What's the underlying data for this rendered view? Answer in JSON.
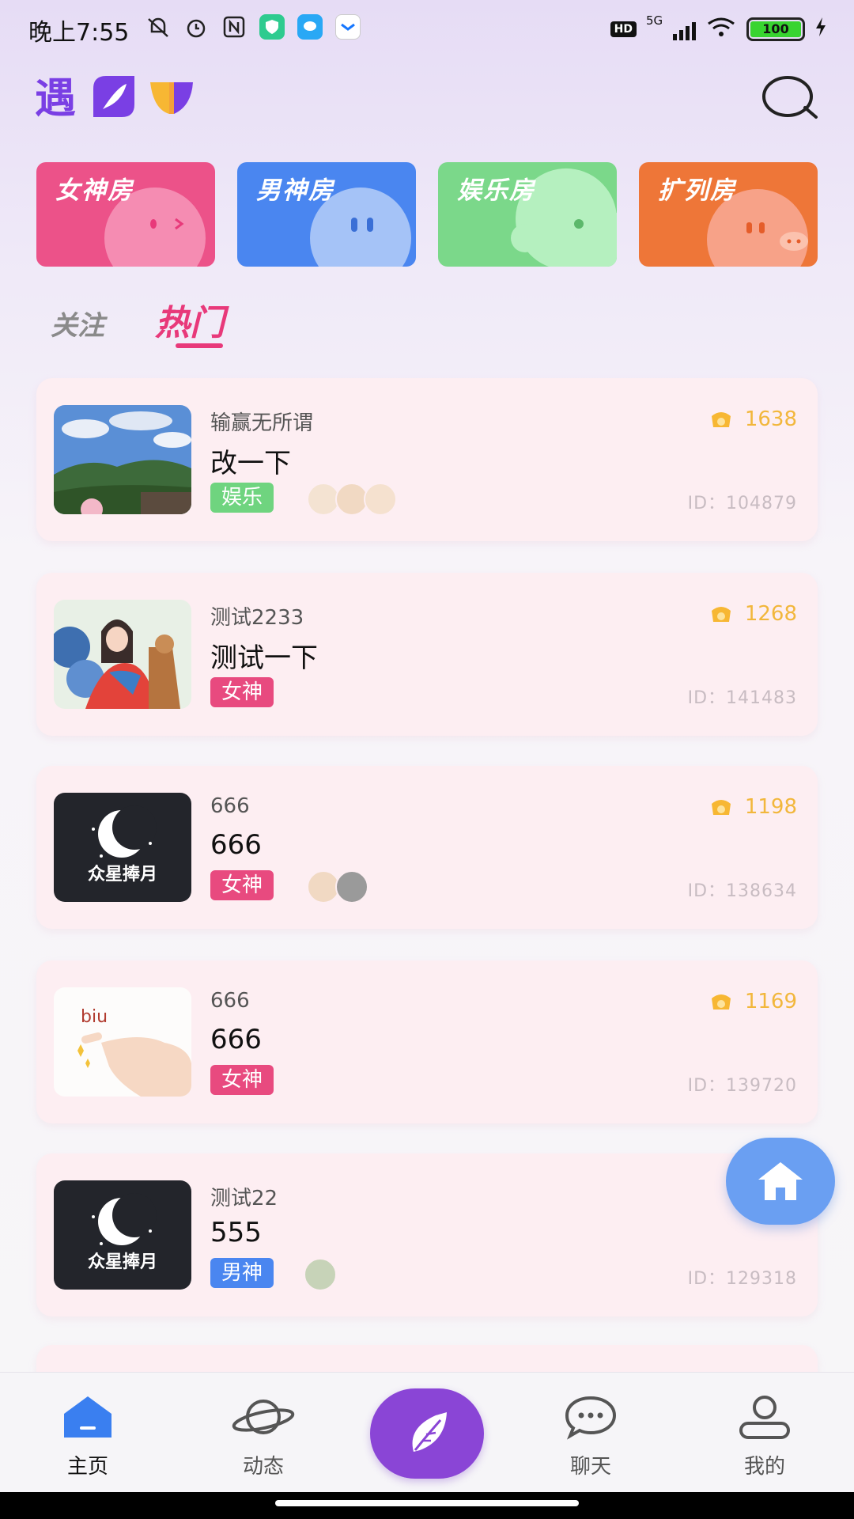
{
  "status_bar": {
    "time": "晚上7:55",
    "network": "5G",
    "hd": "HD",
    "battery": "100"
  },
  "header": {
    "logo_text": "遇"
  },
  "room_categories": [
    {
      "label": "女神房",
      "color": "#ec5289"
    },
    {
      "label": "男神房",
      "color": "#4a86f0"
    },
    {
      "label": "娱乐房",
      "color": "#7bd88a"
    },
    {
      "label": "扩列房",
      "color": "#ee7638"
    }
  ],
  "tabs": {
    "follow": "关注",
    "hot": "热门",
    "active": "hot"
  },
  "rooms": [
    {
      "owner": "输赢无所谓",
      "title": "改一下",
      "tag": "娱乐",
      "tag_type": "ent",
      "hot": "1638",
      "id": "ID：104879",
      "avatar_count": 3
    },
    {
      "owner": "测试2233",
      "title": "测试一下",
      "tag": "女神",
      "tag_type": "goddess",
      "hot": "1268",
      "id": "ID：141483",
      "avatar_count": 0
    },
    {
      "owner": "666",
      "title": "666",
      "tag": "女神",
      "tag_type": "goddess",
      "hot": "1198",
      "id": "ID：138634",
      "avatar_count": 2
    },
    {
      "owner": "666",
      "title": "666",
      "tag": "女神",
      "tag_type": "goddess",
      "hot": "1169",
      "id": "ID：139720",
      "avatar_count": 0
    },
    {
      "owner": "测试22",
      "title": "555",
      "tag": "男神",
      "tag_type": "god",
      "hot": "",
      "id": "ID：129318",
      "avatar_count": 1
    }
  ],
  "thumb_texts": {
    "moon_caption": "众星捧月",
    "biu": "biu"
  },
  "bottom_nav": [
    {
      "label": "主页",
      "icon": "home-icon",
      "active": true
    },
    {
      "label": "动态",
      "icon": "planet-icon",
      "active": false
    },
    {
      "label": "聊天",
      "icon": "chat-icon",
      "active": false
    },
    {
      "label": "我的",
      "icon": "profile-icon",
      "active": false
    }
  ],
  "colors": {
    "accent_pink": "#e8397a",
    "hot_gold": "#f2b73c",
    "center_purple": "#8a45d6",
    "float_blue": "#6a9ff2"
  }
}
